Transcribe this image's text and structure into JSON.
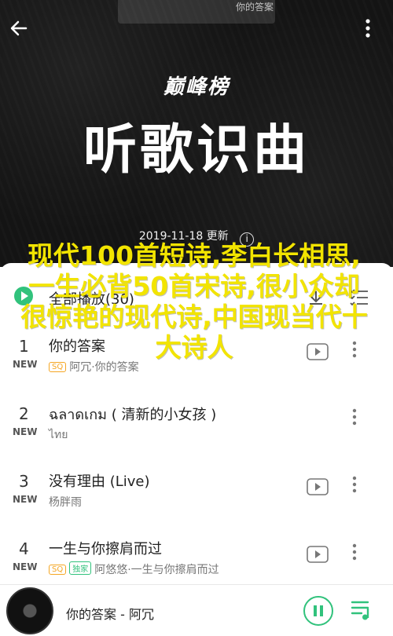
{
  "cover": {
    "top_text": "你的答案",
    "brand": "巅峰榜",
    "title": "听歌识曲",
    "update": "2019-11-18 更新"
  },
  "play_all": {
    "label": "全部播放(30)"
  },
  "songs": [
    {
      "num": "1",
      "new": "NEW",
      "title": "你的答案",
      "tags": [
        "SQ"
      ],
      "meta": "阿冗·你的答案"
    },
    {
      "num": "2",
      "new": "NEW",
      "title": "ฉลาดเกม ( 清新的小女孩 )",
      "tags": [],
      "meta": "ไทย"
    },
    {
      "num": "3",
      "new": "NEW",
      "title": "没有理由 (Live)",
      "tags": [],
      "meta": "杨胖雨"
    },
    {
      "num": "4",
      "new": "NEW",
      "title": "一生与你擦肩而过",
      "tags": [
        "SQ",
        "独家"
      ],
      "meta": "阿悠悠·一生与你擦肩而过"
    }
  ],
  "mini_player": {
    "now_playing": "你的答案 - 阿冗"
  },
  "overlay_text": "现代100首短诗,李白长相思,一生必背50首宋诗,很小众却很惊艳的现代诗,中国现当代十大诗人",
  "colors": {
    "accent": "#31c27c",
    "overlay": "#f2e400"
  }
}
